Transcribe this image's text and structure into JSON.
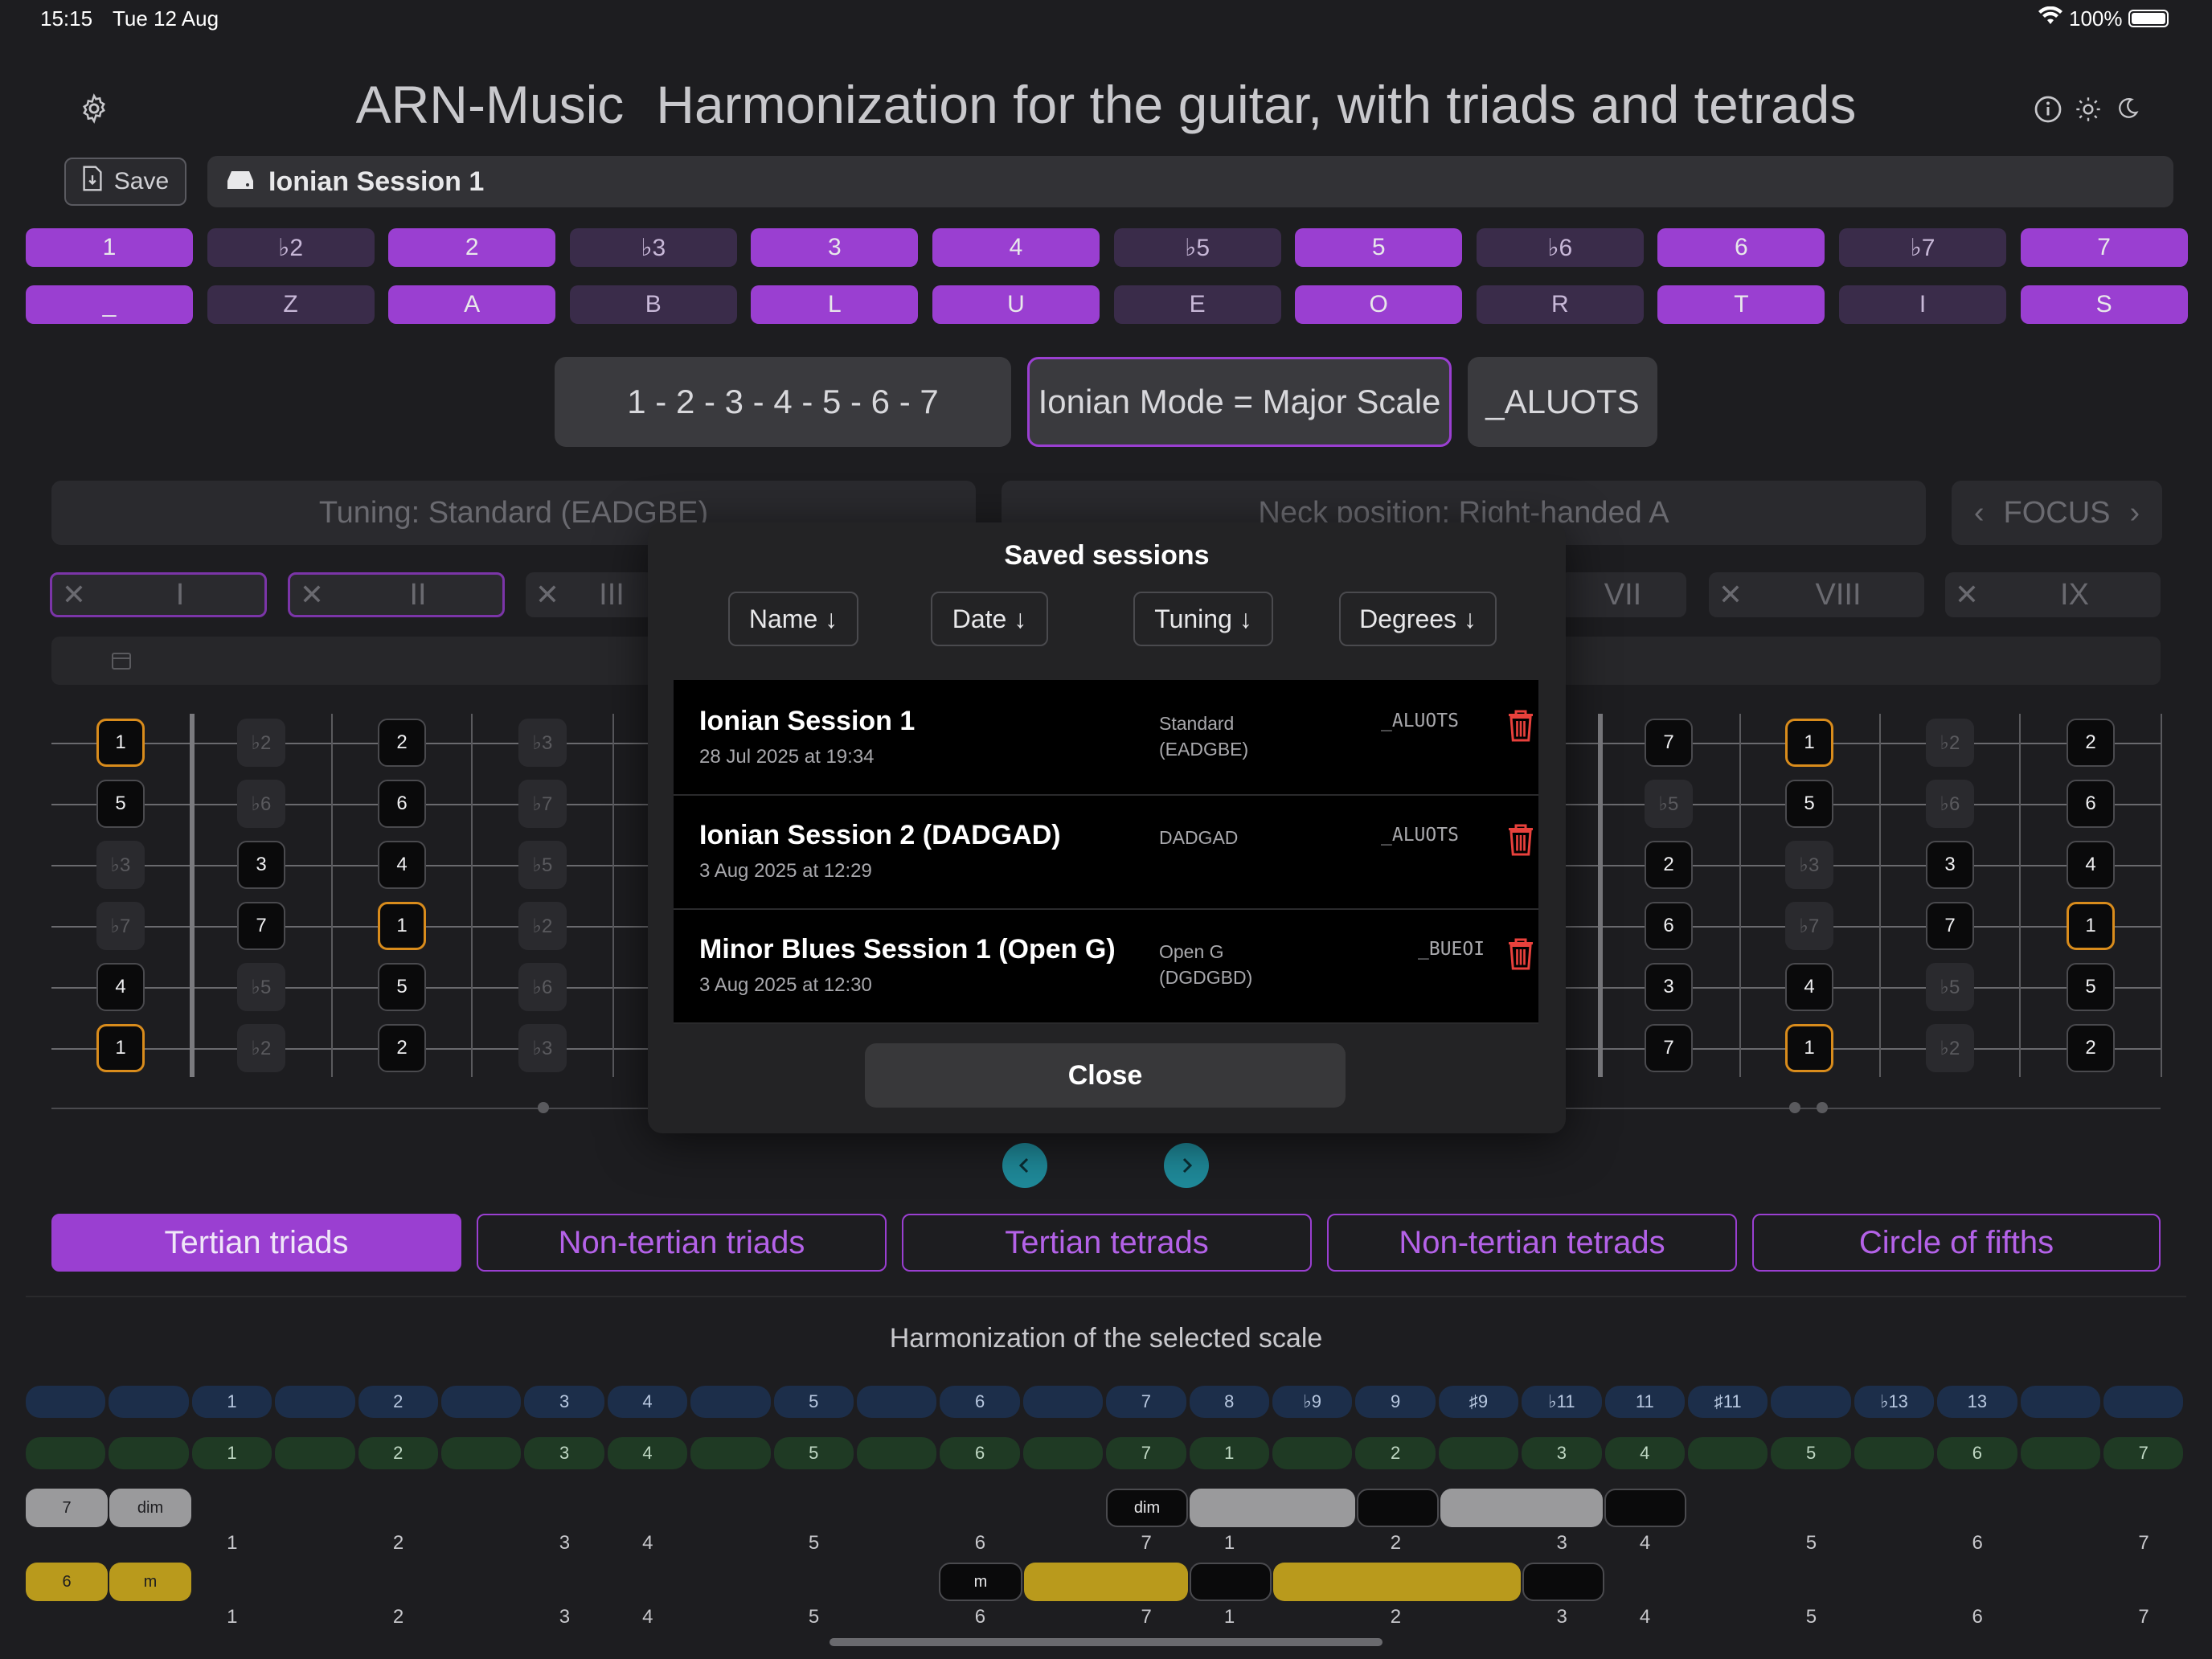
{
  "status": {
    "time": "15:15",
    "date": "Tue 12 Aug",
    "battery": "100%"
  },
  "header": {
    "app": "ARN-Music",
    "title": "Harmonization for the guitar, with triads and tetrads"
  },
  "toolbar": {
    "save_label": "Save",
    "session_name": "Ionian Session 1"
  },
  "degrees": {
    "numbers": [
      "1",
      "♭2",
      "2",
      "♭3",
      "3",
      "4",
      "♭5",
      "5",
      "♭6",
      "6",
      "♭7",
      "7"
    ],
    "letters": [
      "_",
      "Z",
      "A",
      "B",
      "L",
      "U",
      "E",
      "O",
      "R",
      "T",
      "I",
      "S"
    ],
    "active": [
      true,
      false,
      true,
      false,
      true,
      true,
      false,
      true,
      false,
      true,
      false,
      true
    ]
  },
  "scale": {
    "formula": "1 - 2 - 3 - 4 - 5 - 6 - 7",
    "mode": "Ionian Mode = Major Scale",
    "code": "_ALUOTS"
  },
  "controls": {
    "tuning": "Tuning: Standard (EADGBE)",
    "neck": "Neck position: Right-handed A",
    "focus": "FOCUS"
  },
  "positions": [
    "I",
    "II",
    "III",
    "VII",
    "VIII",
    "IX"
  ],
  "fretboard_left": [
    [
      {
        "t": "1",
        "k": "root"
      },
      {
        "t": "♭2",
        "k": "ghost"
      },
      {
        "t": "2",
        "k": "n"
      },
      {
        "t": "♭3",
        "k": "ghost"
      }
    ],
    [
      {
        "t": "5",
        "k": "n"
      },
      {
        "t": "♭6",
        "k": "ghost"
      },
      {
        "t": "6",
        "k": "n"
      },
      {
        "t": "♭7",
        "k": "ghost"
      }
    ],
    [
      {
        "t": "♭3",
        "k": "ghost"
      },
      {
        "t": "3",
        "k": "n"
      },
      {
        "t": "4",
        "k": "n"
      },
      {
        "t": "♭5",
        "k": "ghost"
      }
    ],
    [
      {
        "t": "♭7",
        "k": "ghost"
      },
      {
        "t": "7",
        "k": "n"
      },
      {
        "t": "1",
        "k": "root"
      },
      {
        "t": "♭2",
        "k": "ghost"
      }
    ],
    [
      {
        "t": "4",
        "k": "n"
      },
      {
        "t": "♭5",
        "k": "ghost"
      },
      {
        "t": "5",
        "k": "n"
      },
      {
        "t": "♭6",
        "k": "ghost"
      }
    ],
    [
      {
        "t": "1",
        "k": "root"
      },
      {
        "t": "♭2",
        "k": "ghost"
      },
      {
        "t": "2",
        "k": "n"
      },
      {
        "t": "♭3",
        "k": "ghost"
      }
    ]
  ],
  "fretboard_right": [
    [
      {
        "t": "7",
        "k": "n"
      },
      {
        "t": "1",
        "k": "root"
      },
      {
        "t": "♭2",
        "k": "ghost"
      },
      {
        "t": "2",
        "k": "n"
      }
    ],
    [
      {
        "t": "♭5",
        "k": "ghost"
      },
      {
        "t": "5",
        "k": "n"
      },
      {
        "t": "♭6",
        "k": "ghost"
      },
      {
        "t": "6",
        "k": "n"
      }
    ],
    [
      {
        "t": "2",
        "k": "n"
      },
      {
        "t": "♭3",
        "k": "ghost"
      },
      {
        "t": "3",
        "k": "n"
      },
      {
        "t": "4",
        "k": "n"
      }
    ],
    [
      {
        "t": "6",
        "k": "n"
      },
      {
        "t": "♭7",
        "k": "ghost"
      },
      {
        "t": "7",
        "k": "n"
      },
      {
        "t": "1",
        "k": "root"
      }
    ],
    [
      {
        "t": "3",
        "k": "n"
      },
      {
        "t": "4",
        "k": "n"
      },
      {
        "t": "♭5",
        "k": "ghost"
      },
      {
        "t": "5",
        "k": "n"
      }
    ],
    [
      {
        "t": "7",
        "k": "n"
      },
      {
        "t": "1",
        "k": "root"
      },
      {
        "t": "♭2",
        "k": "ghost"
      },
      {
        "t": "2",
        "k": "n"
      }
    ]
  ],
  "modal": {
    "title": "Saved sessions",
    "sort": [
      "Name ↓",
      "Date ↓",
      "Tuning ↓",
      "Degrees ↓"
    ],
    "sessions": [
      {
        "name": "Ionian Session 1",
        "date": "28 Jul 2025 at 19:34",
        "tuning": "Standard\n(EADGBE)",
        "degrees": "_ALUOTS"
      },
      {
        "name": "Ionian Session 2 (DADGAD)",
        "date": "3 Aug 2025 at 12:29",
        "tuning": "DADGAD",
        "degrees": "_ALUOTS"
      },
      {
        "name": "Minor Blues Session 1 (Open G)",
        "date": "3 Aug 2025 at 12:30",
        "tuning": "Open G\n(DGDGBD)",
        "degrees": "_BUEOI"
      }
    ],
    "close": "Close"
  },
  "tabs": [
    "Tertian triads",
    "Non-tertian triads",
    "Tertian tetrads",
    "Non-tertian tetrads",
    "Circle of fifths"
  ],
  "harmonization": {
    "title": "Harmonization of the selected scale",
    "blue_row": [
      "",
      "",
      "1",
      "",
      "2",
      "",
      "3",
      "4",
      "",
      "5",
      "",
      "6",
      "",
      "7",
      "8",
      "♭9",
      "9",
      "♯9",
      "♭11",
      "11",
      "♯11",
      "",
      "♭13",
      "13",
      "",
      ""
    ],
    "green_row": [
      "",
      "",
      "1",
      "",
      "2",
      "",
      "3",
      "4",
      "",
      "5",
      "",
      "6",
      "",
      "7",
      "1",
      "",
      "2",
      "",
      "3",
      "4",
      "",
      "5",
      "",
      "6",
      "",
      "7"
    ],
    "label_row": [
      "",
      "",
      "1",
      "",
      "2",
      "",
      "3",
      "4",
      "",
      "5",
      "",
      "6",
      "",
      "7",
      "1",
      "",
      "2",
      "",
      "3",
      "4",
      "",
      "5",
      "",
      "6",
      "",
      "7"
    ],
    "row1": {
      "degree": "7",
      "quality": "dim",
      "chip": "dim"
    },
    "row2": {
      "degree": "6",
      "quality": "m",
      "chip": "m"
    }
  }
}
